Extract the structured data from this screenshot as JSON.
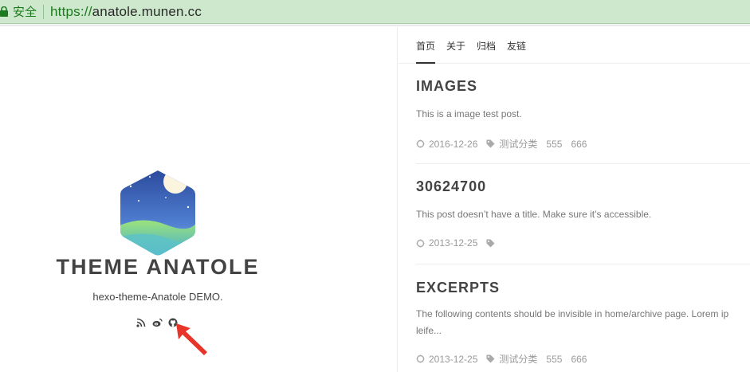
{
  "browser": {
    "secure_label": "安全",
    "url_scheme": "https://",
    "url_host": "anatole.munen.cc"
  },
  "sidebar": {
    "title": "THEME ANATOLE",
    "description": "hexo-theme-Anatole DEMO.",
    "social_icons": [
      "rss-icon",
      "weibo-icon",
      "github-icon"
    ]
  },
  "nav": {
    "items": [
      {
        "label": "首页"
      },
      {
        "label": "关于"
      },
      {
        "label": "归档"
      },
      {
        "label": "友链"
      }
    ]
  },
  "posts": [
    {
      "title": "IMAGES",
      "excerpt": "This is a image test post.",
      "date": "2016-12-26",
      "category": "测试分类",
      "tags": [
        "555",
        "666"
      ]
    },
    {
      "title": "30624700",
      "excerpt": "This post doesn’t have a title. Make sure it’s accessible.",
      "date": "2013-12-25",
      "category": "",
      "tags": []
    },
    {
      "title": "EXCERPTS",
      "excerpt": "The following contents should be invisible in home/archive page. Lorem ip",
      "excerpt_line2": "leife...",
      "date": "2013-12-25",
      "category": "测试分类",
      "tags": [
        "555",
        "666"
      ]
    }
  ],
  "colors": {
    "address_bar": "#cde8cd",
    "secure_green": "#1e7a1e",
    "title_text": "#434343",
    "meta_text": "#999999",
    "arrow_red": "#e8352a"
  }
}
